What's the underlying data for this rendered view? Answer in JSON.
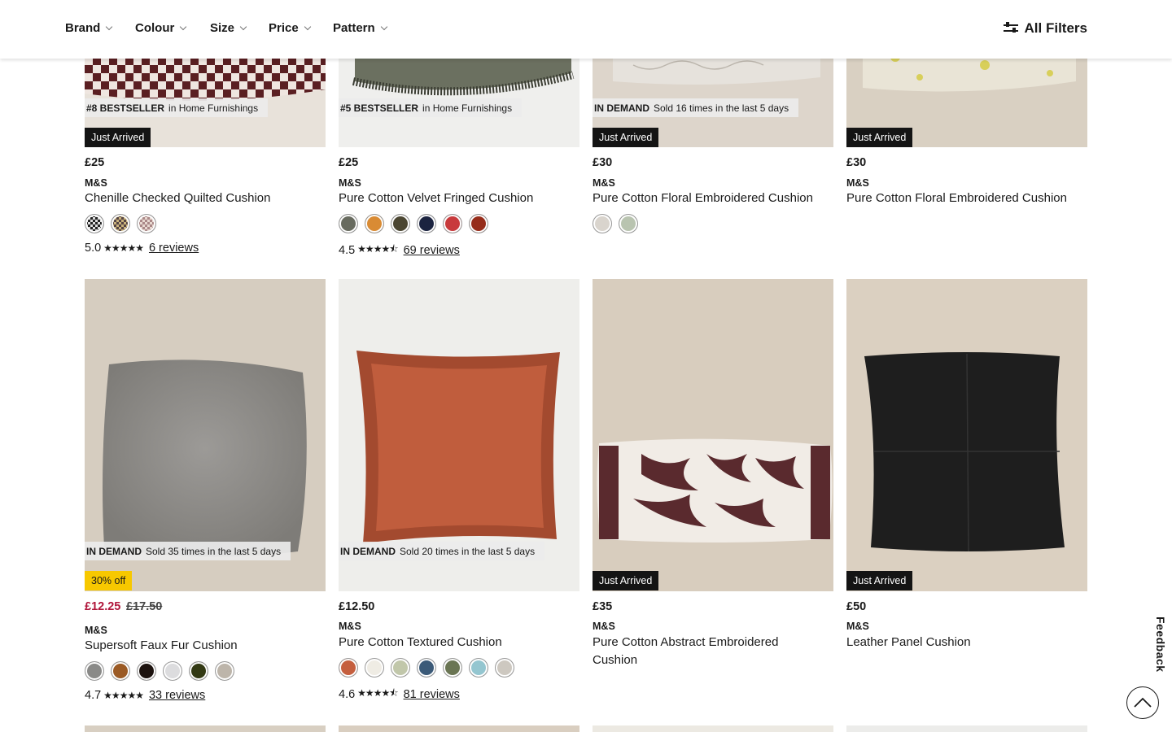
{
  "filters": {
    "brand": "Brand",
    "colour": "Colour",
    "size": "Size",
    "price": "Price",
    "pattern": "Pattern",
    "all_filters": "All Filters"
  },
  "products": [
    {
      "badge_label": "#8 BESTSELLER",
      "badge_text": "in Home Furnishings",
      "tag": "Just Arrived",
      "price": "£25",
      "brand": "M&S",
      "name": "Chenille Checked Quilted Cushion",
      "swatches": [
        "#444",
        "#b59a5a",
        "#c8a897"
      ],
      "rating": "5.0",
      "stars": "★★★★★",
      "reviews": "6 reviews"
    },
    {
      "badge_label": "#5 BESTSELLER",
      "badge_text": "in Home Furnishings",
      "price": "£25",
      "brand": "M&S",
      "name": "Pure Cotton Velvet Fringed Cushion",
      "swatches": [
        "#686b5f",
        "#d98b34",
        "#4b4632",
        "#1b2340",
        "#c83a3c",
        "#962c1a"
      ],
      "rating": "4.5",
      "stars": "★★★★⯪",
      "reviews": "69 reviews"
    },
    {
      "badge_label": "IN DEMAND",
      "badge_text": "Sold 16 times in the last 5 days",
      "tag": "Just Arrived",
      "price": "£30",
      "brand": "M&S",
      "name": "Pure Cotton Floral Embroidered Cushion",
      "swatches": [
        "#d9d4cd",
        "#b9c4b0"
      ]
    },
    {
      "tag": "Just Arrived",
      "price": "£30",
      "brand": "M&S",
      "name": "Pure Cotton Floral Embroidered Cushion"
    },
    {
      "badge_label": "IN DEMAND",
      "badge_text": "Sold 35 times in the last 5 days",
      "offer": "30% off",
      "price": "£12.25",
      "was_price": "£17.50",
      "brand": "M&S",
      "name": "Supersoft Faux Fur Cushion",
      "swatches": [
        "#8a8a88",
        "#9b5a24",
        "#1c120e",
        "#dcdcde",
        "#333a14",
        "#bdb5aa"
      ],
      "rating": "4.7",
      "stars": "★★★★★",
      "reviews": "33 reviews"
    },
    {
      "badge_label": "IN DEMAND",
      "badge_text": "Sold 20 times in the last 5 days",
      "price": "£12.50",
      "brand": "M&S",
      "name": "Pure Cotton Textured Cushion",
      "swatches": [
        "#c55f3e",
        "#efece4",
        "#c1c7aa",
        "#3b5a78",
        "#6a7553",
        "#94c6d0",
        "#cdc8c0"
      ],
      "rating": "4.6",
      "stars": "★★★★⯪",
      "reviews": "81 reviews"
    },
    {
      "tag": "Just Arrived",
      "price": "£35",
      "brand": "M&S",
      "name": "Pure Cotton Abstract Embroidered Cushion"
    },
    {
      "tag": "Just Arrived",
      "price": "£50",
      "brand": "M&S",
      "name": "Leather Panel Cushion"
    }
  ],
  "feedback": "Feedback",
  "colors": {
    "sale": "#b0153a",
    "offer_badge": "#f7c800",
    "just_arrived_badge": "#141414"
  }
}
